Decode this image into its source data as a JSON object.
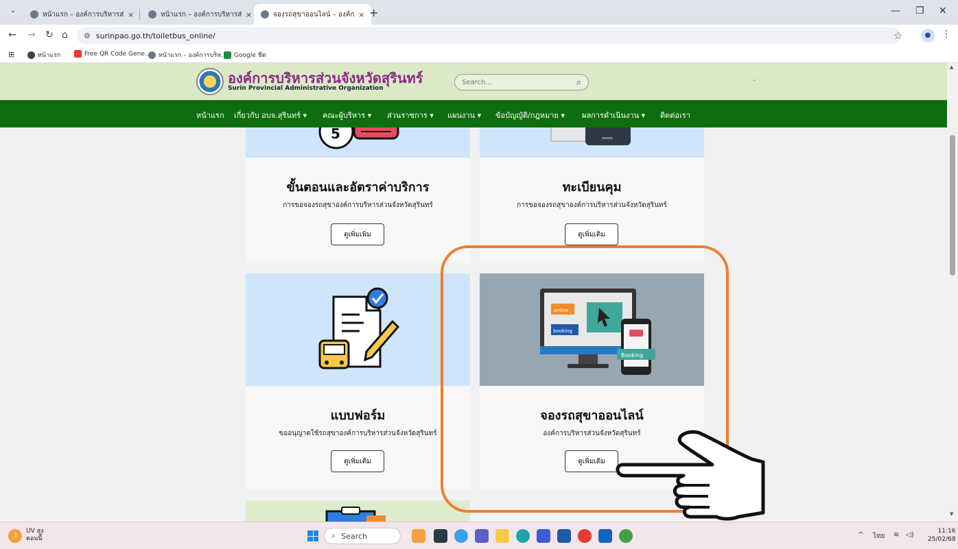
{
  "browser": {
    "tabs": [
      {
        "title": "หน้าแรก – องค์การบริหารส่วนจังหวัด",
        "active": false
      },
      {
        "title": "หน้าแรก – องค์การบริหารส่วนจังหวัด",
        "active": false
      },
      {
        "title": "จองรถสุขาออนไลน์ – องค์การบริหาร",
        "active": true
      }
    ],
    "close_glyph": "×",
    "new_tab": "+",
    "url": "surinpao.go.th/toiletbus_online/",
    "bookmarks": [
      {
        "label": "หน้าแรก",
        "color": "#444444"
      },
      {
        "label": "Free QR Code Gene...",
        "color": "#e53935"
      },
      {
        "label": "หน้าแรก – องค์การบริห...",
        "color": "#6a7a8a"
      },
      {
        "label": "Google ชีต",
        "color": "#1e8e3e"
      }
    ]
  },
  "site": {
    "name_th": "องค์การบริหารส่วนจังหวัดสุรินทร์",
    "name_en": "Surin Provincial Administrative Organization",
    "search_placeholder": "Search...",
    "header_dash": "-",
    "nav": [
      {
        "label": "หน้าแรก",
        "dropdown": false
      },
      {
        "label": "เกี่ยวกับ อบจ.สุรินทร์",
        "dropdown": true
      },
      {
        "label": "คณะผู้บริหาร",
        "dropdown": true
      },
      {
        "label": "ส่วนราชการ",
        "dropdown": true
      },
      {
        "label": "แผนงาน",
        "dropdown": true
      },
      {
        "label": "ข้อบัญญัติ/กฎหมาย",
        "dropdown": true
      },
      {
        "label": "ผลการดำเนินงาน",
        "dropdown": true
      },
      {
        "label": "ติดต่อเรา",
        "dropdown": false
      }
    ]
  },
  "cards": [
    {
      "title": "ขั้นตอนและอัตราค่าบริการ",
      "subtitle": "การขอจองรถสุขาองค์การบริหารส่วนจังหวัดสุรินทร์",
      "button": "ดูเพิ่มเพิ่ม"
    },
    {
      "title": "ทะเบียนคุม",
      "subtitle": "การขอจองรถสุขาองค์การบริหารส่วนจังหวัดสุรินทร์",
      "button": "ดูเพิ่มเติม"
    },
    {
      "title": "แบบฟอร์ม",
      "subtitle": "ขออนุญาตใช้รถสุขาองค์การบริหารส่วนจังหวัดสุรินทร์",
      "button": "ดูเพิ่มเติม"
    },
    {
      "title": "จองรถสุขาออนไลน์",
      "subtitle": "องค์การบริหารส่วนจังหวัดสุรินทร์",
      "button": "ดูเพิ่มเติม"
    }
  ],
  "booking_illustration": {
    "online": "online",
    "booking": "booking",
    "phone_label": "Booking"
  },
  "taskbar": {
    "weather_badge": "3",
    "weather_line1": "UV สูง",
    "weather_line2": "ตอนนี้",
    "search_label": "Search",
    "language": "ไทย",
    "time": "11:16",
    "date": "25/02/68"
  },
  "colors": {
    "header_bg": "#dbe9c7",
    "nav_bg": "#0e6e0e",
    "highlight": "#ec7e2f",
    "card_image_bg": "#cfe5fb",
    "booking_image_bg": "#98a6b2"
  }
}
